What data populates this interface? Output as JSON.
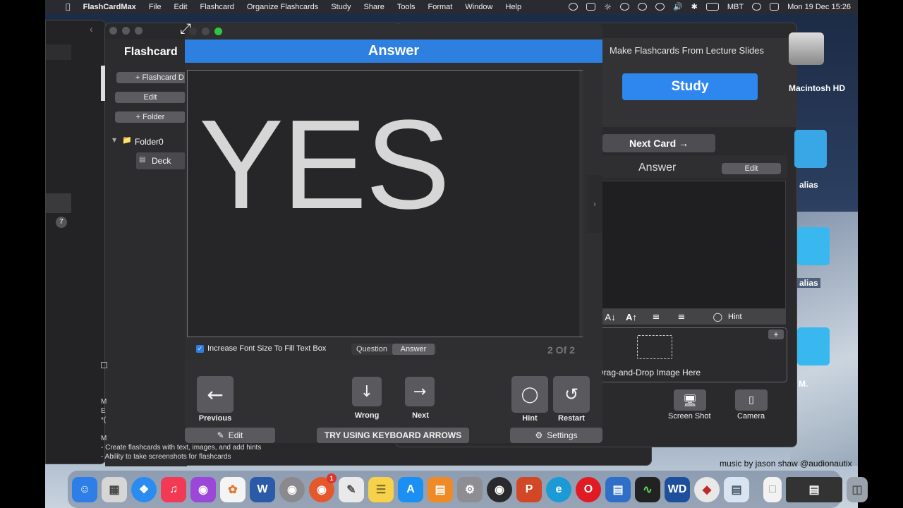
{
  "menubar": {
    "app_name": "FlashCardMax",
    "items": [
      "File",
      "Edit",
      "Flashcard",
      "Organize Flashcards",
      "Study",
      "Share",
      "Tools",
      "Format",
      "Window",
      "Help"
    ],
    "status_text": "MBT",
    "clock": "Mon 19 Dec  15:26"
  },
  "main_window": {
    "title": "Flashcard",
    "flashcard_deck_button": "+ Flashcard D",
    "edit_button": "Edit",
    "folder_button": "+ Folder",
    "folder_name": "Folder0",
    "deck_name": "Deck",
    "bottom_lines": [
      "M",
      "E",
      "*(",
      "M",
      "- Create flashcards with text, images, and add hints",
      "- Ability to take screenshots for flashcards"
    ]
  },
  "left_window": {
    "badge": "7"
  },
  "popup": {
    "title": "Answer",
    "card_text": "YES",
    "increase_font_label": "Increase Font Size To Fill Text Box",
    "increase_font_checked": true,
    "segment_question": "Question",
    "segment_answer": "Answer",
    "counter": "2 Of 2",
    "previous_label": "Previous",
    "wrong_label": "Wrong",
    "next_label": "Next",
    "hint_label": "Hint",
    "restart_label": "Restart",
    "edit_label": "Edit",
    "keyboard_tip": "TRY USING KEYBOARD ARROWS",
    "settings_label": "Settings"
  },
  "right_panel": {
    "header": "Make Flashcards From Lecture Slides",
    "study_button": "Study",
    "next_card_button": "Next Card →",
    "answer_heading": "Answer",
    "edit_button": "Edit",
    "hint_button": "Hint",
    "drop_text": "Drag-and-Drop Image Here",
    "screenshot_label": "Screen Shot",
    "camera_label": "Camera"
  },
  "desktop": {
    "items": [
      "Macintosh HD",
      "alias",
      "alias",
      "M."
    ],
    "credit": "music by jason shaw @audionautix"
  },
  "dock": {
    "icons": [
      "finder-icon",
      "launchpad-icon",
      "safari-icon",
      "music-icon",
      "podcasts-icon",
      "photos-icon",
      "word-icon",
      "screenflow-icon",
      "firefox-icon",
      "textedit-icon",
      "notes-icon",
      "appstore-icon",
      "books-icon",
      "system-preferences-icon",
      "obs-icon",
      "powerpoint-icon",
      "edge-icon",
      "opera-icon",
      "screens-icon",
      "activity-monitor-icon",
      "wd-icon",
      "flashcardmax-icon",
      "preview-icon",
      "document-icon",
      "finder-window-icon",
      "trash-icon"
    ],
    "badge": "1"
  },
  "colors": {
    "accent": "#2d7fe0",
    "study": "#2e87ee",
    "button_grey": "#5a5a5e",
    "panel": "#2f2f31"
  }
}
